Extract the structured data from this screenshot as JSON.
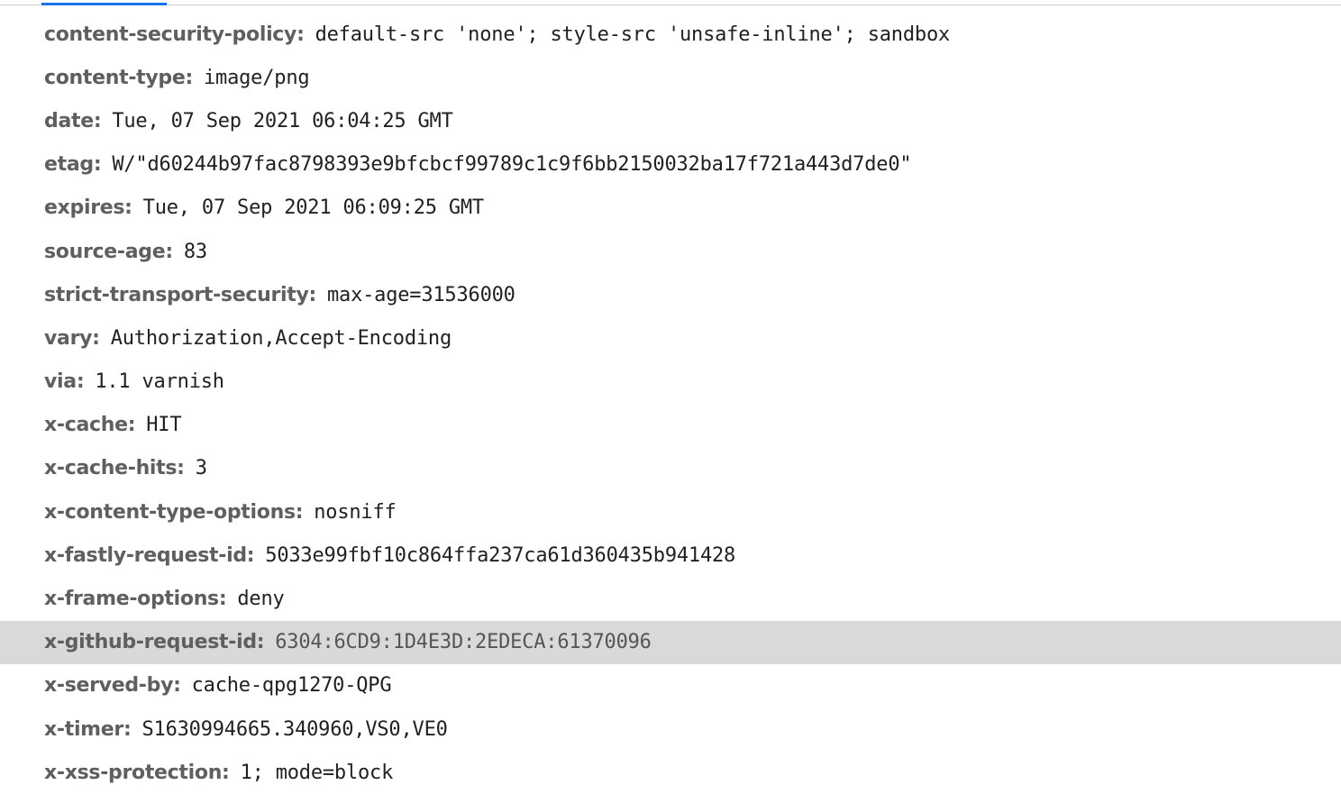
{
  "headers": [
    {
      "name": "content-security-policy:",
      "value": "default-src 'none'; style-src 'unsafe-inline'; sandbox"
    },
    {
      "name": "content-type:",
      "value": "image/png"
    },
    {
      "name": "date:",
      "value": "Tue, 07 Sep 2021 06:04:25 GMT"
    },
    {
      "name": "etag:",
      "value": "W/\"d60244b97fac8798393e9bfcbcf99789c1c9f6bb2150032ba17f721a443d7de0\""
    },
    {
      "name": "expires:",
      "value": "Tue, 07 Sep 2021 06:09:25 GMT"
    },
    {
      "name": "source-age:",
      "value": "83"
    },
    {
      "name": "strict-transport-security:",
      "value": "max-age=31536000"
    },
    {
      "name": "vary:",
      "value": "Authorization,Accept-Encoding"
    },
    {
      "name": "via:",
      "value": "1.1 varnish"
    },
    {
      "name": "x-cache:",
      "value": "HIT"
    },
    {
      "name": "x-cache-hits:",
      "value": "3"
    },
    {
      "name": "x-content-type-options:",
      "value": "nosniff"
    },
    {
      "name": "x-fastly-request-id:",
      "value": "5033e99fbf10c864ffa237ca61d360435b941428"
    },
    {
      "name": "x-frame-options:",
      "value": "deny"
    },
    {
      "name": "x-github-request-id:",
      "value": "6304:6CD9:1D4E3D:2EDECA:61370096"
    },
    {
      "name": "x-served-by:",
      "value": "cache-qpg1270-QPG"
    },
    {
      "name": "x-timer:",
      "value": "S1630994665.340960,VS0,VE0"
    },
    {
      "name": "x-xss-protection:",
      "value": "1; mode=block"
    }
  ]
}
